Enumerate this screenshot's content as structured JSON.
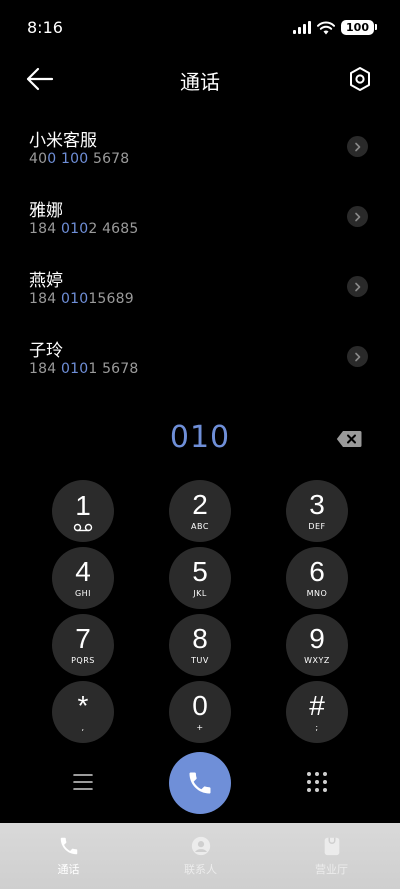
{
  "status_bar": {
    "time": "8:16",
    "battery": "100"
  },
  "header": {
    "title": "通话"
  },
  "contacts": [
    {
      "name": "小米客服",
      "number_pre": "40",
      "number_hl": "0 100",
      "number_post": " 5678"
    },
    {
      "name": "雅娜",
      "number_pre": "184 ",
      "number_hl": "010",
      "number_post": "2 4685"
    },
    {
      "name": "燕婷",
      "number_pre": "184 ",
      "number_hl": "010",
      "number_post": "15689"
    },
    {
      "name": "子玲",
      "number_pre": "184 ",
      "number_hl": "010",
      "number_post": "1 5678"
    }
  ],
  "dialed_number": "010",
  "keypad": [
    {
      "digit": "1",
      "letters": ""
    },
    {
      "digit": "2",
      "letters": "ABC"
    },
    {
      "digit": "3",
      "letters": "DEF"
    },
    {
      "digit": "4",
      "letters": "GHI"
    },
    {
      "digit": "5",
      "letters": "JKL"
    },
    {
      "digit": "6",
      "letters": "MNO"
    },
    {
      "digit": "7",
      "letters": "PQRS"
    },
    {
      "digit": "8",
      "letters": "TUV"
    },
    {
      "digit": "9",
      "letters": "WXYZ"
    },
    {
      "digit": "*",
      "letters": ","
    },
    {
      "digit": "0",
      "letters": "+"
    },
    {
      "digit": "#",
      "letters": ";"
    }
  ],
  "bottom_nav": [
    {
      "label": "通话",
      "icon": "phone-icon",
      "active": true
    },
    {
      "label": "联系人",
      "icon": "contacts-icon",
      "active": false
    },
    {
      "label": "营业厅",
      "icon": "store-icon",
      "active": false
    }
  ],
  "colors": {
    "accent": "#6f8fd8",
    "key_bg": "#2b2b2b",
    "background": "#000000"
  }
}
